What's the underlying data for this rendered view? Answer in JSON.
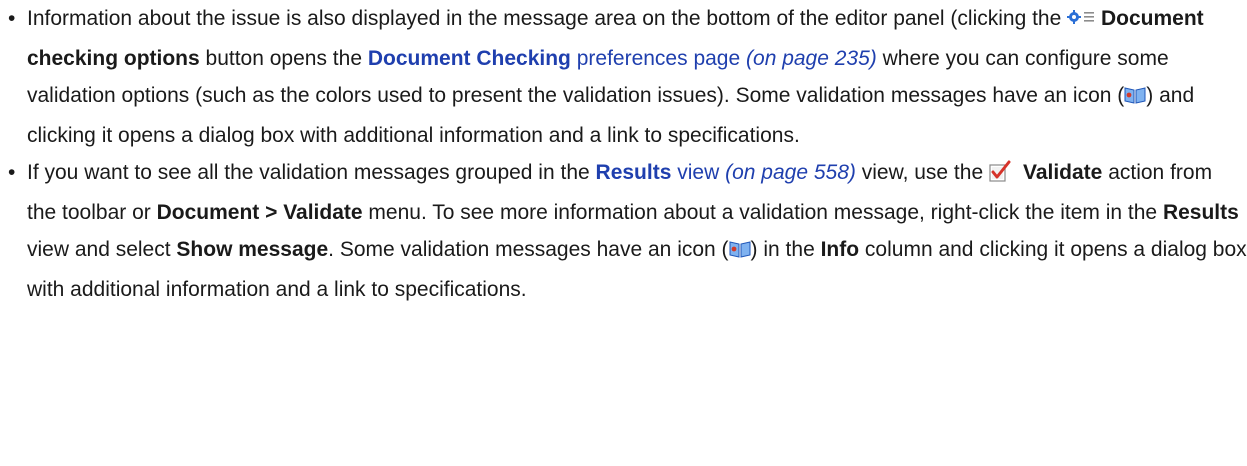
{
  "item1": {
    "bullet": "•",
    "t1": "Information about the issue is also displayed in the message area on the bottom of the editor panel (clicking the",
    "btn": "Document checking options",
    "t2": "button opens the",
    "link_bold": "Document Checking",
    "link_text": "preferences page",
    "pageref": "(on page 235)",
    "t3": "where you can configure some validation options (such as the colors used to present the validation issues). Some validation messages have an icon (",
    "t4": ") and clicking it opens a dialog box with additional information and a link to specifications."
  },
  "item2": {
    "bullet": "•",
    "t1": "If you want to see all the validation messages grouped in the",
    "link_bold": "Results",
    "link_text": "view",
    "pageref": "(on page 558)",
    "t2": "view, use the",
    "validate": "Validate",
    "t3": "action from the toolbar or",
    "menu": "Document > Validate",
    "t4": "menu. To see more information about a validation message, right-click the item in the",
    "results": "Results",
    "t5": "view and select",
    "show": "Show message",
    "t6": ". Some validation messages have an icon (",
    "t7": ") in the",
    "info": "Info",
    "t8": "column and clicking it opens a dialog box with additional information and a link to specifications."
  },
  "icons": {
    "options": "document-checking-options-icon",
    "info_book": "info-book-icon",
    "validate": "validate-checkmark-icon"
  }
}
